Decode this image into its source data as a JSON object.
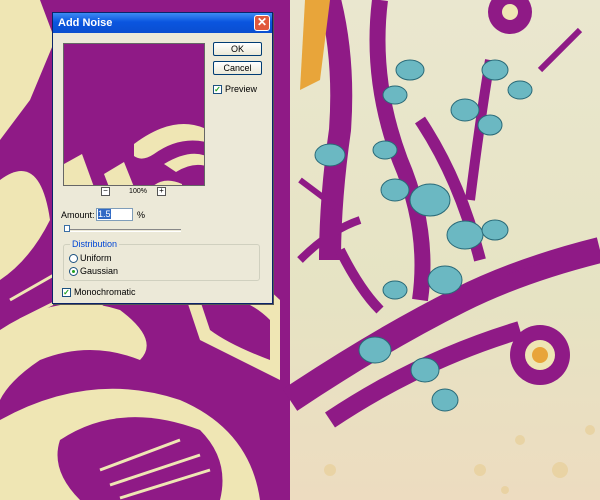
{
  "dialog": {
    "title": "Add Noise",
    "close_label": "✕",
    "ok_label": "OK",
    "cancel_label": "Cancel",
    "preview_label": "Preview",
    "preview_checked": true,
    "zoom_minus": "−",
    "zoom_plus": "+",
    "zoom_level": "100%",
    "amount_label": "Amount:",
    "amount_value": "1.5",
    "amount_unit": "%",
    "distribution_label": "Distribution",
    "uniform_label": "Uniform",
    "gaussian_label": "Gaussian",
    "selected_distribution": "Gaussian",
    "monochromatic_label": "Monochromatic",
    "monochromatic_checked": true
  },
  "colors": {
    "artwork_purple": "#8f1a86",
    "artwork_cream": "#efe6b4",
    "leaf_teal": "#6bb8c2",
    "background_cream": "#ede6c8"
  }
}
